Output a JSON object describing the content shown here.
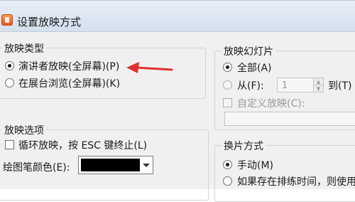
{
  "dialog": {
    "title": "设置放映方式"
  },
  "show_type": {
    "legend": "放映类型",
    "options": [
      {
        "label": "演讲者放映(全屏幕)(P)",
        "selected": true
      },
      {
        "label": "在展台浏览(全屏幕)(K)",
        "selected": false
      }
    ]
  },
  "show_slides": {
    "legend": "放映幻灯片",
    "all_label": "全部(A)",
    "from_label": "从(F):",
    "from_value": "1",
    "to_label": "到(T)",
    "custom_label": "自定义放映(C):",
    "selected": "all"
  },
  "show_options": {
    "legend": "放映选项",
    "loop_label": "循环放映，按 ESC 键终止(L)",
    "loop_checked": false,
    "pen_color_label": "绘图笔颜色(E):",
    "pen_color": "#000000"
  },
  "advance": {
    "legend": "换片方式",
    "options": [
      {
        "label": "手动(M)",
        "selected": true
      },
      {
        "label": "如果存在排练时间，则使用",
        "selected": false
      }
    ]
  },
  "colors": {
    "arrow": "#e03030",
    "title_bar": "#dae4f1",
    "app_icon": "#ef6a2a"
  },
  "icons": {
    "app": "presentation-app-icon",
    "annotation": "red-arrow-icon"
  }
}
